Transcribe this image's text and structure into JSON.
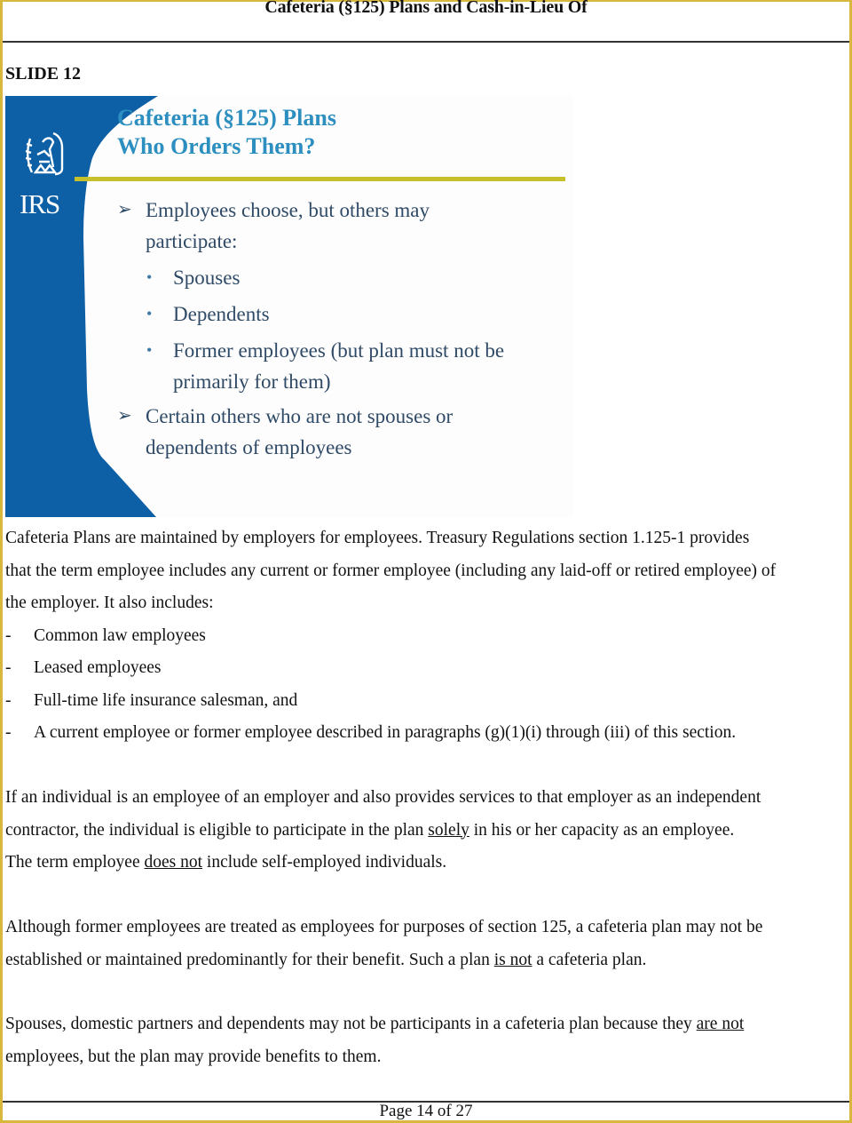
{
  "document": {
    "running_header": "Cafeteria (§125) Plans and Cash-in-Lieu Of",
    "slide_label": "SLIDE 12",
    "page_number": "Page 14 of 27"
  },
  "slide": {
    "logo_text": "IRS",
    "title_line1": "Cafeteria (§125) Plans",
    "title_line2": "Who Orders  Them?",
    "colors": {
      "panel_blue": "#0d5fa6",
      "title_blue": "#2d8fbf",
      "rule_yellow": "#c6c12a",
      "text_navy": "#2f4a66"
    },
    "bullets": [
      {
        "icon": "arrow-bullet-icon",
        "text_line1": "Employees  choose, but others may",
        "text_line2": "participate:",
        "sub_items": [
          "Spouses",
          "Dependents",
          "Former employees (but plan must not be",
          "primarily  for them)"
        ]
      },
      {
        "icon": "arrow-bullet-icon",
        "text_line1": "Certain  others who are not spouses or",
        "text_line2": "dependents of employees"
      }
    ]
  },
  "body": {
    "p1_line1": "Cafeteria Plans are maintained by employers for employees.  Treasury Regulations section 1.125-1 provides",
    "p1_line2": "that the term employee includes any current or former employee (including any laid-off or retired employee) of",
    "p1_line3": "the employer.  It also includes:",
    "dash_marker": "-",
    "includes": [
      "Common law employees",
      "Leased employees",
      "Full-time life insurance salesman, and",
      "A current employee or former employee described in paragraphs (g)(1)(i) through (iii) of this section."
    ],
    "p2_line1": "If an individual is an employee of an employer and also provides services to that employer as an independent",
    "p2_line2_a": "contractor, the individual is eligible to participate in the plan ",
    "p2_line2_u": "solely",
    "p2_line2_b": " in his or her capacity as an employee.",
    "p2_line3_a": "The term employee ",
    "p2_line3_u": "does not",
    "p2_line3_b": " include self-employed individuals.",
    "p3_line1": "Although former employees are treated as employees for purposes of section 125, a cafeteria plan may not be",
    "p3_line2_a": "established or maintained predominantly for their benefit.  Such a plan ",
    "p3_line2_u": "is not",
    "p3_line2_b": " a cafeteria plan.",
    "p4_line1_a": "Spouses, domestic partners and dependents may not be participants in a cafeteria plan because they ",
    "p4_line1_u": "are not",
    "p4_line2": "employees, but the plan may provide benefits to them."
  }
}
